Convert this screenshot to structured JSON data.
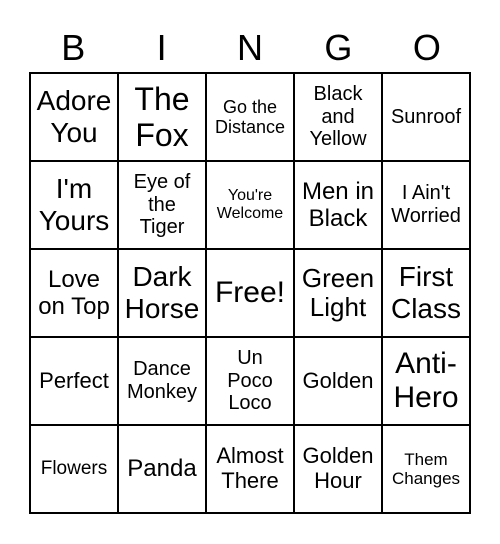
{
  "header": [
    "B",
    "I",
    "N",
    "G",
    "O"
  ],
  "cells": [
    "Adore You",
    "The Fox",
    "Go the Distance",
    "Black and Yellow",
    "Sunroof",
    "I'm Yours",
    "Eye of the Tiger",
    "You're Welcome",
    "Men in Black",
    "I Ain't Worried",
    "Love on Top",
    "Dark Horse",
    "Free!",
    "Green Light",
    "First Class",
    "Perfect",
    "Dance Monkey",
    "Un Poco Loco",
    "Golden",
    "Anti-Hero",
    "Flowers",
    "Panda",
    "Almost There",
    "Golden Hour",
    "Them Changes"
  ]
}
